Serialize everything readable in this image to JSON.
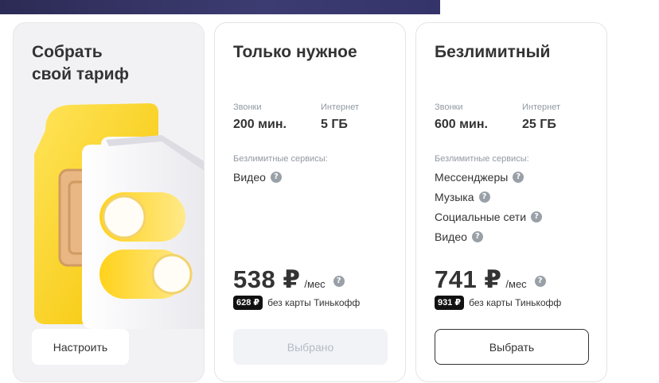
{
  "colors": {
    "accent_yellow": "#ffdd2d",
    "text_primary": "#333333",
    "text_muted": "#9299a2",
    "button_disabled_bg": "#f1f3f6",
    "button_disabled_text": "#b5bcc6",
    "badge_bg": "#111111"
  },
  "custom_card": {
    "title": "Собрать\nсвой тариф",
    "illustration": "sim-card-illustration",
    "button_label": "Настроить"
  },
  "plans": [
    {
      "title": "Только нужное",
      "calls_label": "Звонки",
      "calls_value": "200 мин.",
      "internet_label": "Интернет",
      "internet_value": "5 ГБ",
      "services_label": "Безлимитные сервисы:",
      "services": [
        "Видео"
      ],
      "price": "538 ₽",
      "period": "/мес",
      "no_card_price": "628 ₽",
      "no_card_note": "без карты Тинькофф",
      "button_label": "Выбрано",
      "selected": true
    },
    {
      "title": "Безлимитный",
      "calls_label": "Звонки",
      "calls_value": "600 мин.",
      "internet_label": "Интернет",
      "internet_value": "25 ГБ",
      "services_label": "Безлимитные сервисы:",
      "services": [
        "Мессенджеры",
        "Музыка",
        "Социальные сети",
        "Видео"
      ],
      "price": "741 ₽",
      "period": "/мес",
      "no_card_price": "931 ₽",
      "no_card_note": "без карты Тинькофф",
      "button_label": "Выбрать",
      "selected": false
    }
  ],
  "help_glyph": "?"
}
